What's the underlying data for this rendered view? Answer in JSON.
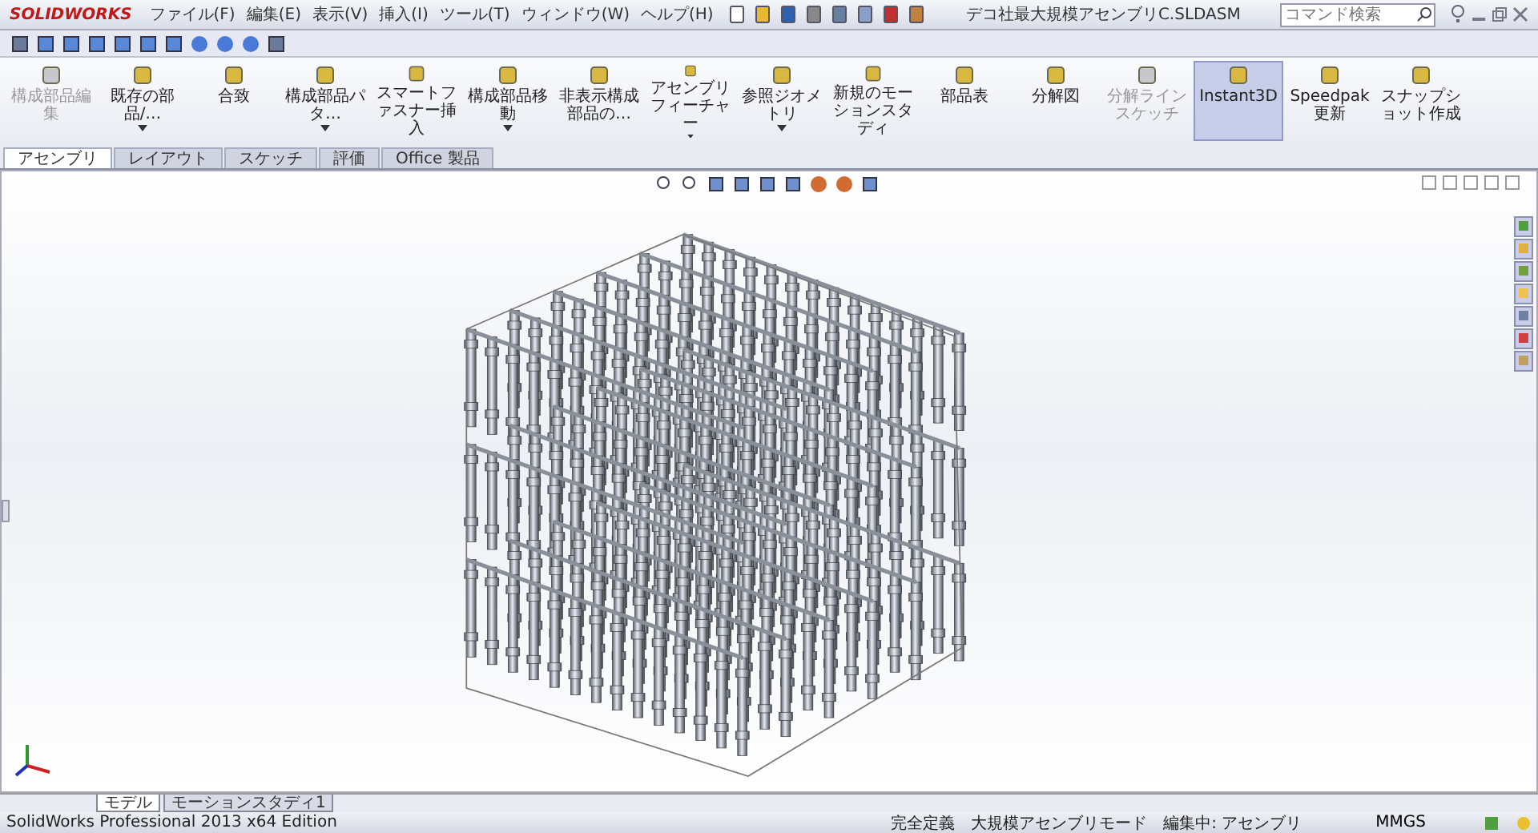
{
  "app": {
    "brand": "SOLIDWORKS",
    "title": "デコ社最大規模アセンブリC.SLDASM",
    "search": {
      "placeholder": "コマンド検索"
    }
  },
  "menus": [
    "ファイル(F)",
    "編集(E)",
    "表示(V)",
    "挿入(I)",
    "ツール(T)",
    "ウィンドウ(W)",
    "ヘルプ(H)"
  ],
  "commands": [
    {
      "label": "構成部品編集",
      "disabled": true,
      "selected": false,
      "has_menu": false
    },
    {
      "label": "既存の部品/…",
      "disabled": false,
      "selected": false,
      "has_menu": true
    },
    {
      "label": "合致",
      "disabled": false,
      "selected": false,
      "has_menu": false
    },
    {
      "label": "構成部品パタ…",
      "disabled": false,
      "selected": false,
      "has_menu": true
    },
    {
      "label": "スマートファスナー挿入",
      "disabled": false,
      "selected": false,
      "has_menu": false
    },
    {
      "label": "構成部品移動",
      "disabled": false,
      "selected": false,
      "has_menu": true
    },
    {
      "label": "非表示構成部品の…",
      "disabled": false,
      "selected": false,
      "has_menu": false
    },
    {
      "label": "アセンブリフィーチャー",
      "disabled": false,
      "selected": false,
      "has_menu": true
    },
    {
      "label": "参照ジオメトリ",
      "disabled": false,
      "selected": false,
      "has_menu": true
    },
    {
      "label": "新規のモーションスタディ",
      "disabled": false,
      "selected": false,
      "has_menu": false
    },
    {
      "label": "部品表",
      "disabled": false,
      "selected": false,
      "has_menu": false
    },
    {
      "label": "分解図",
      "disabled": false,
      "selected": false,
      "has_menu": false
    },
    {
      "label": "分解ラインスケッチ",
      "disabled": true,
      "selected": false,
      "has_menu": false
    },
    {
      "label": "Instant3D",
      "disabled": false,
      "selected": true,
      "has_menu": false
    },
    {
      "label": "Speedpak更新",
      "disabled": false,
      "selected": false,
      "has_menu": false
    },
    {
      "label": "スナップショット作成",
      "disabled": false,
      "selected": false,
      "has_menu": false
    }
  ],
  "tabs": [
    {
      "label": "アセンブリ",
      "selected": true
    },
    {
      "label": "レイアウト",
      "selected": false
    },
    {
      "label": "スケッチ",
      "selected": false
    },
    {
      "label": "評価",
      "selected": false
    },
    {
      "label": "Office 製品",
      "selected": false
    }
  ],
  "bottom_tabs": [
    {
      "label": "モデル",
      "selected": true
    },
    {
      "label": "モーションスタディ1",
      "selected": false
    }
  ],
  "status_bar": {
    "product": "SolidWorks Professional 2013 x64 Edition",
    "items": [
      "完全定義",
      "大規模アセンブリモード",
      "編集中: アセンブリ"
    ],
    "units": "MMGS"
  }
}
